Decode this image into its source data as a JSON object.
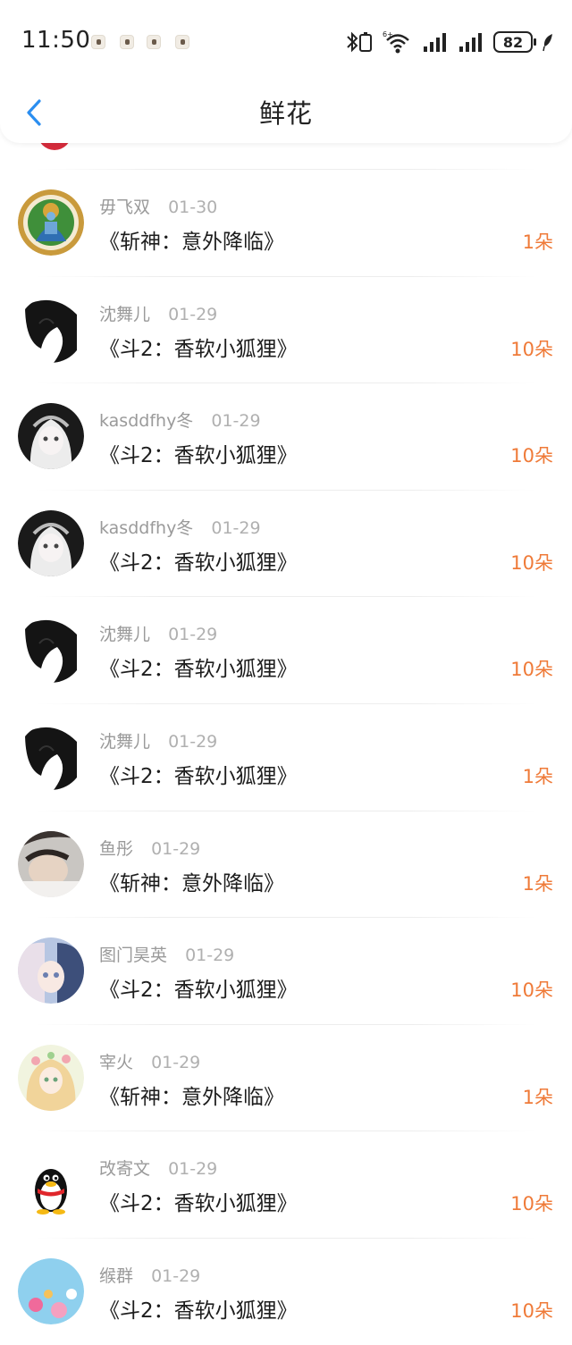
{
  "status_bar": {
    "time": "11:50",
    "battery": "82"
  },
  "nav": {
    "title": "鲜花"
  },
  "records": [
    {
      "name": "毋飞双",
      "date": "01-30",
      "book": "《斩神：意外降临》",
      "count": "1朵",
      "avatar": "deity"
    },
    {
      "name": "沈舞儿",
      "date": "01-29",
      "book": "《斗2：香软小狐狸》",
      "count": "10朵",
      "avatar": "dark-hair"
    },
    {
      "name": "kasddfhy冬",
      "date": "01-29",
      "book": "《斗2：香软小狐狸》",
      "count": "10朵",
      "avatar": "white-hair"
    },
    {
      "name": "kasddfhy冬",
      "date": "01-29",
      "book": "《斗2：香软小狐狸》",
      "count": "10朵",
      "avatar": "white-hair"
    },
    {
      "name": "沈舞儿",
      "date": "01-29",
      "book": "《斗2：香软小狐狸》",
      "count": "10朵",
      "avatar": "dark-hair"
    },
    {
      "name": "沈舞儿",
      "date": "01-29",
      "book": "《斗2：香软小狐狸》",
      "count": "1朵",
      "avatar": "dark-hair"
    },
    {
      "name": "鱼彤",
      "date": "01-29",
      "book": "《斩神：意外降临》",
      "count": "1朵",
      "avatar": "photo"
    },
    {
      "name": "图门昊英",
      "date": "01-29",
      "book": "《斗2：香软小狐狸》",
      "count": "10朵",
      "avatar": "anime"
    },
    {
      "name": "宰火",
      "date": "01-29",
      "book": "《斩神：意外降临》",
      "count": "1朵",
      "avatar": "flower-girl"
    },
    {
      "name": "改寄文",
      "date": "01-29",
      "book": "《斗2：香软小狐狸》",
      "count": "10朵",
      "avatar": "penguin"
    },
    {
      "name": "缑群",
      "date": "01-29",
      "book": "《斗2：香软小狐狸》",
      "count": "10朵",
      "avatar": "flowers"
    }
  ],
  "colors": {
    "accent_count": "#ef7a38",
    "back_arrow": "#2b8ef0"
  }
}
